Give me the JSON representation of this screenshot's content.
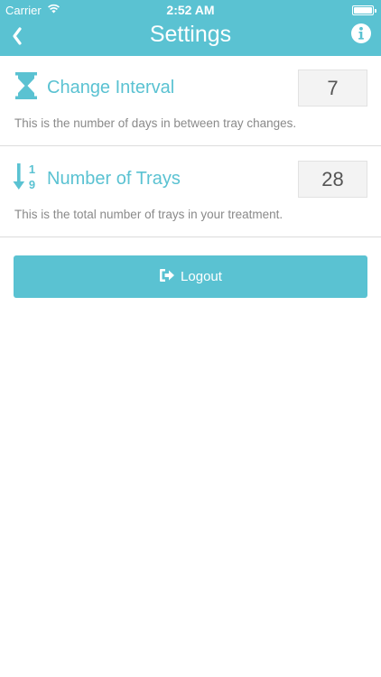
{
  "status_bar": {
    "carrier": "Carrier",
    "time": "2:52 AM"
  },
  "nav": {
    "title": "Settings",
    "back_icon": "chevron-left-icon",
    "info_icon": "info-icon"
  },
  "settings": [
    {
      "label": "Change Interval",
      "value": "7",
      "description": "This is the number of days in between tray changes.",
      "icon": "hourglass-icon"
    },
    {
      "label": "Number of Trays",
      "value": "28",
      "description": "This is the total number of trays in your treatment.",
      "icon": "sort-numeric-down-icon"
    }
  ],
  "logout": {
    "label": "Logout",
    "icon": "sign-out-icon"
  },
  "colors": {
    "accent": "#5ac2d2",
    "value_bg": "#f3f3f3",
    "description": "#8a8a8a",
    "divider": "#dcdcdc"
  }
}
